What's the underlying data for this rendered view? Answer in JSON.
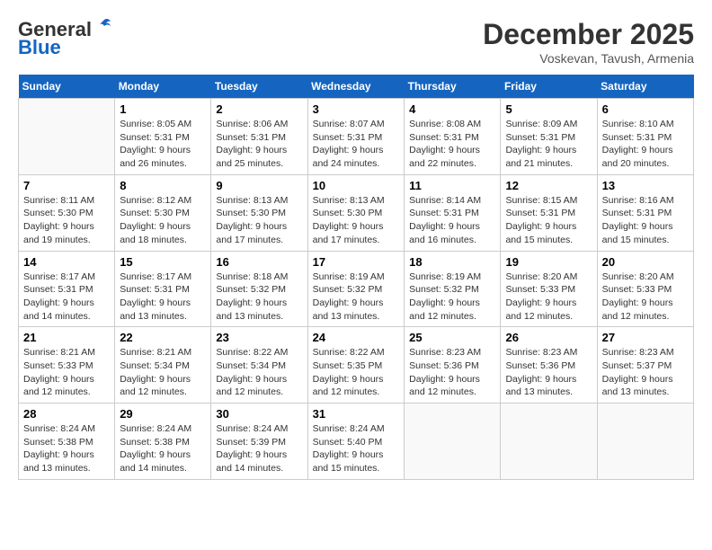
{
  "logo": {
    "general": "General",
    "blue": "Blue"
  },
  "title": "December 2025",
  "location": "Voskevan, Tavush, Armenia",
  "weekdays": [
    "Sunday",
    "Monday",
    "Tuesday",
    "Wednesday",
    "Thursday",
    "Friday",
    "Saturday"
  ],
  "weeks": [
    [
      {
        "day": "",
        "sunrise": "",
        "sunset": "",
        "daylight": ""
      },
      {
        "day": "1",
        "sunrise": "Sunrise: 8:05 AM",
        "sunset": "Sunset: 5:31 PM",
        "daylight": "Daylight: 9 hours and 26 minutes."
      },
      {
        "day": "2",
        "sunrise": "Sunrise: 8:06 AM",
        "sunset": "Sunset: 5:31 PM",
        "daylight": "Daylight: 9 hours and 25 minutes."
      },
      {
        "day": "3",
        "sunrise": "Sunrise: 8:07 AM",
        "sunset": "Sunset: 5:31 PM",
        "daylight": "Daylight: 9 hours and 24 minutes."
      },
      {
        "day": "4",
        "sunrise": "Sunrise: 8:08 AM",
        "sunset": "Sunset: 5:31 PM",
        "daylight": "Daylight: 9 hours and 22 minutes."
      },
      {
        "day": "5",
        "sunrise": "Sunrise: 8:09 AM",
        "sunset": "Sunset: 5:31 PM",
        "daylight": "Daylight: 9 hours and 21 minutes."
      },
      {
        "day": "6",
        "sunrise": "Sunrise: 8:10 AM",
        "sunset": "Sunset: 5:31 PM",
        "daylight": "Daylight: 9 hours and 20 minutes."
      }
    ],
    [
      {
        "day": "7",
        "sunrise": "Sunrise: 8:11 AM",
        "sunset": "Sunset: 5:30 PM",
        "daylight": "Daylight: 9 hours and 19 minutes."
      },
      {
        "day": "8",
        "sunrise": "Sunrise: 8:12 AM",
        "sunset": "Sunset: 5:30 PM",
        "daylight": "Daylight: 9 hours and 18 minutes."
      },
      {
        "day": "9",
        "sunrise": "Sunrise: 8:13 AM",
        "sunset": "Sunset: 5:30 PM",
        "daylight": "Daylight: 9 hours and 17 minutes."
      },
      {
        "day": "10",
        "sunrise": "Sunrise: 8:13 AM",
        "sunset": "Sunset: 5:30 PM",
        "daylight": "Daylight: 9 hours and 17 minutes."
      },
      {
        "day": "11",
        "sunrise": "Sunrise: 8:14 AM",
        "sunset": "Sunset: 5:31 PM",
        "daylight": "Daylight: 9 hours and 16 minutes."
      },
      {
        "day": "12",
        "sunrise": "Sunrise: 8:15 AM",
        "sunset": "Sunset: 5:31 PM",
        "daylight": "Daylight: 9 hours and 15 minutes."
      },
      {
        "day": "13",
        "sunrise": "Sunrise: 8:16 AM",
        "sunset": "Sunset: 5:31 PM",
        "daylight": "Daylight: 9 hours and 15 minutes."
      }
    ],
    [
      {
        "day": "14",
        "sunrise": "Sunrise: 8:17 AM",
        "sunset": "Sunset: 5:31 PM",
        "daylight": "Daylight: 9 hours and 14 minutes."
      },
      {
        "day": "15",
        "sunrise": "Sunrise: 8:17 AM",
        "sunset": "Sunset: 5:31 PM",
        "daylight": "Daylight: 9 hours and 13 minutes."
      },
      {
        "day": "16",
        "sunrise": "Sunrise: 8:18 AM",
        "sunset": "Sunset: 5:32 PM",
        "daylight": "Daylight: 9 hours and 13 minutes."
      },
      {
        "day": "17",
        "sunrise": "Sunrise: 8:19 AM",
        "sunset": "Sunset: 5:32 PM",
        "daylight": "Daylight: 9 hours and 13 minutes."
      },
      {
        "day": "18",
        "sunrise": "Sunrise: 8:19 AM",
        "sunset": "Sunset: 5:32 PM",
        "daylight": "Daylight: 9 hours and 12 minutes."
      },
      {
        "day": "19",
        "sunrise": "Sunrise: 8:20 AM",
        "sunset": "Sunset: 5:33 PM",
        "daylight": "Daylight: 9 hours and 12 minutes."
      },
      {
        "day": "20",
        "sunrise": "Sunrise: 8:20 AM",
        "sunset": "Sunset: 5:33 PM",
        "daylight": "Daylight: 9 hours and 12 minutes."
      }
    ],
    [
      {
        "day": "21",
        "sunrise": "Sunrise: 8:21 AM",
        "sunset": "Sunset: 5:33 PM",
        "daylight": "Daylight: 9 hours and 12 minutes."
      },
      {
        "day": "22",
        "sunrise": "Sunrise: 8:21 AM",
        "sunset": "Sunset: 5:34 PM",
        "daylight": "Daylight: 9 hours and 12 minutes."
      },
      {
        "day": "23",
        "sunrise": "Sunrise: 8:22 AM",
        "sunset": "Sunset: 5:34 PM",
        "daylight": "Daylight: 9 hours and 12 minutes."
      },
      {
        "day": "24",
        "sunrise": "Sunrise: 8:22 AM",
        "sunset": "Sunset: 5:35 PM",
        "daylight": "Daylight: 9 hours and 12 minutes."
      },
      {
        "day": "25",
        "sunrise": "Sunrise: 8:23 AM",
        "sunset": "Sunset: 5:36 PM",
        "daylight": "Daylight: 9 hours and 12 minutes."
      },
      {
        "day": "26",
        "sunrise": "Sunrise: 8:23 AM",
        "sunset": "Sunset: 5:36 PM",
        "daylight": "Daylight: 9 hours and 13 minutes."
      },
      {
        "day": "27",
        "sunrise": "Sunrise: 8:23 AM",
        "sunset": "Sunset: 5:37 PM",
        "daylight": "Daylight: 9 hours and 13 minutes."
      }
    ],
    [
      {
        "day": "28",
        "sunrise": "Sunrise: 8:24 AM",
        "sunset": "Sunset: 5:38 PM",
        "daylight": "Daylight: 9 hours and 13 minutes."
      },
      {
        "day": "29",
        "sunrise": "Sunrise: 8:24 AM",
        "sunset": "Sunset: 5:38 PM",
        "daylight": "Daylight: 9 hours and 14 minutes."
      },
      {
        "day": "30",
        "sunrise": "Sunrise: 8:24 AM",
        "sunset": "Sunset: 5:39 PM",
        "daylight": "Daylight: 9 hours and 14 minutes."
      },
      {
        "day": "31",
        "sunrise": "Sunrise: 8:24 AM",
        "sunset": "Sunset: 5:40 PM",
        "daylight": "Daylight: 9 hours and 15 minutes."
      },
      {
        "day": "",
        "sunrise": "",
        "sunset": "",
        "daylight": ""
      },
      {
        "day": "",
        "sunrise": "",
        "sunset": "",
        "daylight": ""
      },
      {
        "day": "",
        "sunrise": "",
        "sunset": "",
        "daylight": ""
      }
    ]
  ]
}
